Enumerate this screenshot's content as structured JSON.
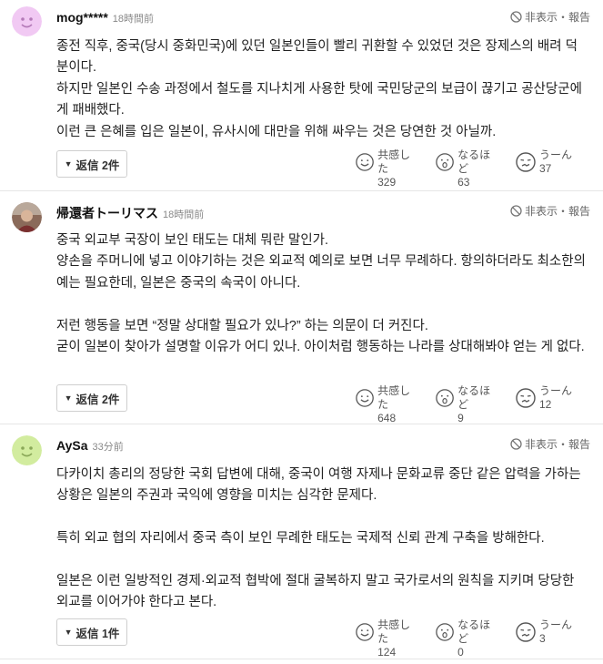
{
  "hide_report_label": "非表示・報告",
  "reaction_labels": {
    "agree": "共感した",
    "insight": "なるほど",
    "doubt": "うーん"
  },
  "comments": [
    {
      "user": "mog*****",
      "time": "18時間前",
      "paragraphs": [
        "종전 직후, 중국(당시 중화민국)에 있던 일본인들이 빨리 귀환할 수 있었던 것은 장제스의 배려 덕분이다.",
        "하지만 일본인 수송 과정에서 철도를 지나치게 사용한 탓에 국민당군의 보급이 끊기고 공산당군에게 패배했다.",
        "이런 큰 은혜를 입은 일본이, 유사시에 대만을 위해 싸우는 것은 당연한 것 아닐까."
      ],
      "reply_label": "返信 2件",
      "counts": {
        "agree": "329",
        "insight": "63",
        "doubt": "37"
      }
    },
    {
      "user": "帰還者トーリマス",
      "time": "18時間前",
      "paragraphs": [
        "중국 외교부 국장이 보인 태도는 대체 뭐란 말인가.",
        "양손을 주머니에 넣고 이야기하는 것은 외교적 예의로 보면 너무 무례하다. 항의하더라도 최소한의 예는 필요한데, 일본은 중국의 속국이 아니다.",
        "",
        "저런 행동을 보면 “정말 상대할 필요가 있나?” 하는 의문이 더 커진다.",
        "굳이 일본이 찾아가 설명할 이유가 어디 있나. 아이처럼 행동하는 나라를 상대해봐야 얻는 게 없다."
      ],
      "reply_label": "返信 2件",
      "counts": {
        "agree": "648",
        "insight": "9",
        "doubt": "12"
      }
    },
    {
      "user": "AySa",
      "time": "33分前",
      "paragraphs": [
        "다카이치 총리의 정당한 국회 답변에 대해, 중국이 여행 자제나 문화교류 중단 같은 압력을 가하는 상황은 일본의 주권과 국익에 영향을 미치는 심각한 문제다.",
        "",
        "특히 외교 협의 자리에서 중국 측이 보인 무례한 태도는 국제적 신뢰 관계 구축을 방해한다.",
        "",
        "일본은 이런 일방적인 경제·외교적 협박에 절대 굴복하지 말고 국가로서의 원칙을 지키며 당당한 외교를 이어가야 한다고 본다."
      ],
      "reply_label": "返信 1件",
      "counts": {
        "agree": "124",
        "insight": "0",
        "doubt": "3"
      }
    }
  ]
}
